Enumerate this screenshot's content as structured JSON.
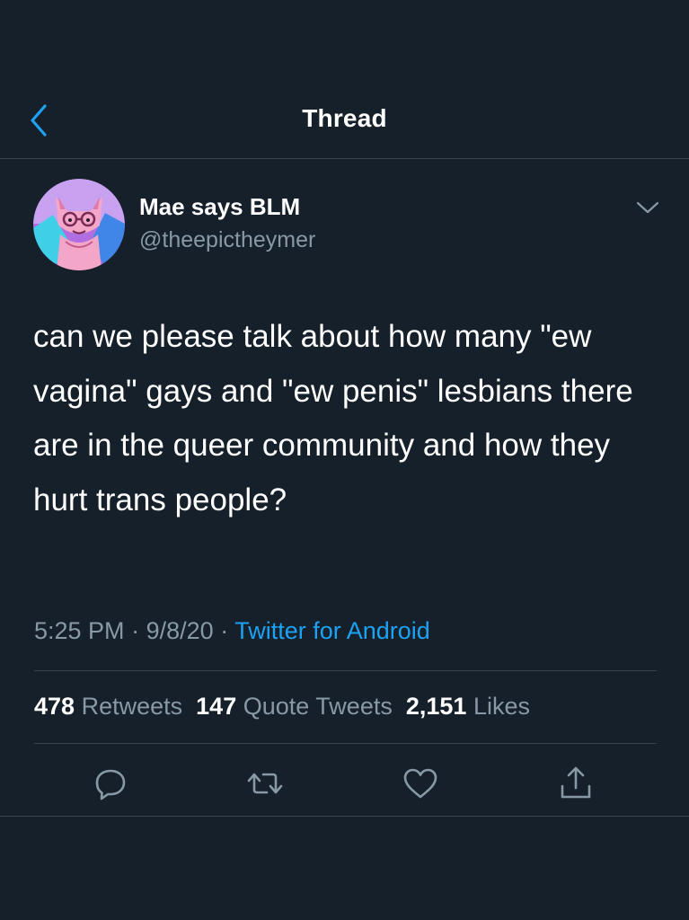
{
  "header": {
    "title": "Thread",
    "back_icon": "chevron-left-icon"
  },
  "tweet": {
    "author": {
      "display_name": "Mae says BLM",
      "handle": "@theepictheymer"
    },
    "text": "can we please talk about how many \"ew vagina\" gays and \"ew penis\" lesbians there are in the queer community and how they hurt trans people?",
    "time": "5:25 PM",
    "date": "9/8/20",
    "separator": "·",
    "source": "Twitter for Android",
    "stats": {
      "retweets_count": "478",
      "retweets_label": "Retweets",
      "quotes_count": "147",
      "quotes_label": "Quote Tweets",
      "likes_count": "2,151",
      "likes_label": "Likes"
    }
  },
  "actions": [
    "reply-icon",
    "retweet-icon",
    "like-icon",
    "share-icon"
  ],
  "colors": {
    "background": "#15202b",
    "divider": "#38444d",
    "accent": "#1da1f2",
    "secondary_text": "#8899a6",
    "primary_text": "#ffffff"
  }
}
